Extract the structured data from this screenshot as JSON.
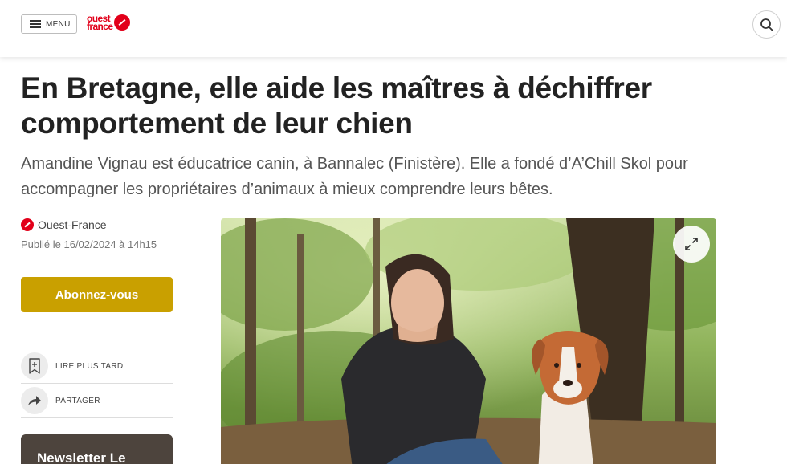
{
  "header": {
    "menu_label": "MENU",
    "logo": {
      "line1": "ouest",
      "line2": "france"
    },
    "search_icon": "search-icon"
  },
  "article": {
    "title": "En Bretagne, elle aide les maîtres à déchiffrer comportement de leur chien",
    "lede": "Amandine Vignau est éducatrice canin, à Bannalec (Finistère). Elle a fondé d’A’Chill Skol pour accompagner les propriétaires d’animaux à mieux comprendre leurs bêtes.",
    "source": "Ouest-France",
    "published": "Publié le 16/02/2024 à 14h15"
  },
  "sidebar": {
    "subscribe_label": "Abonnez-vous",
    "actions": [
      {
        "label": "LIRE PLUS TARD",
        "icon": "bookmark-add-icon"
      },
      {
        "label": "PARTAGER",
        "icon": "share-arrow-icon"
      }
    ],
    "newsletter_label": "Newsletter Le"
  },
  "photo": {
    "expand_icon": "expand-icon"
  },
  "colors": {
    "brand_red": "#e2001a",
    "subscribe_gold": "#c9a000",
    "newsletter_brown": "#4d443d"
  }
}
